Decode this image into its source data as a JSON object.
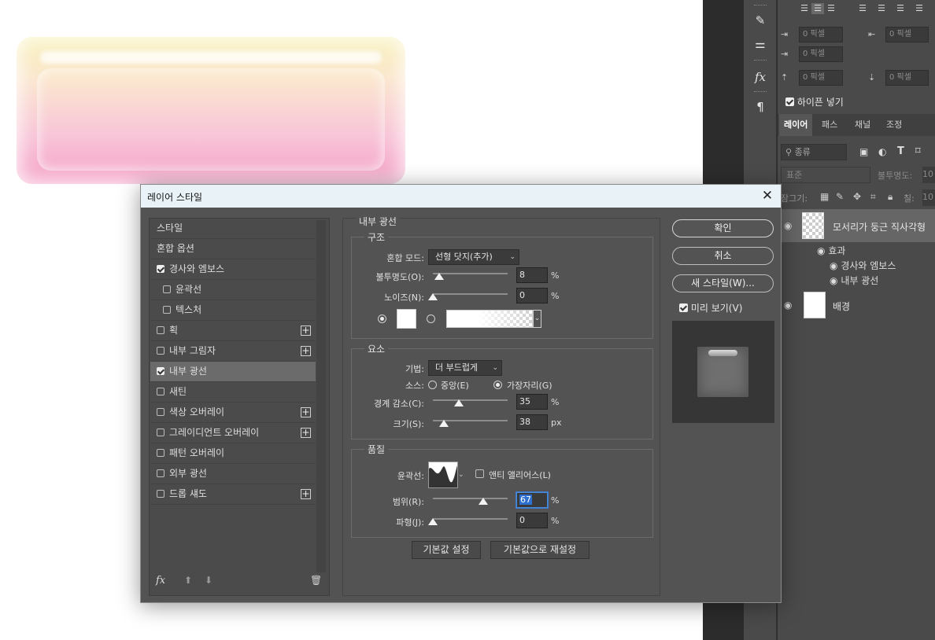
{
  "dialog": {
    "title": "레이어 스타일",
    "ok_label": "확인",
    "cancel_label": "취소",
    "new_style_label": "새 스타일(W)...",
    "preview_label": "미리 보기(V)",
    "preview_checked": true
  },
  "styles_list": [
    {
      "label": "스타일",
      "checkbox": null,
      "plus": false,
      "selected": false
    },
    {
      "label": "혼합 옵션",
      "checkbox": null,
      "plus": false,
      "selected": false
    },
    {
      "label": "경사와 엠보스",
      "checkbox": true,
      "plus": false,
      "selected": false
    },
    {
      "label": "윤곽선",
      "checkbox": false,
      "plus": false,
      "selected": false,
      "sub": true
    },
    {
      "label": "텍스처",
      "checkbox": false,
      "plus": false,
      "selected": false,
      "sub": true
    },
    {
      "label": "획",
      "checkbox": false,
      "plus": true,
      "selected": false
    },
    {
      "label": "내부 그림자",
      "checkbox": false,
      "plus": true,
      "selected": false
    },
    {
      "label": "내부 광선",
      "checkbox": true,
      "plus": false,
      "selected": true
    },
    {
      "label": "새틴",
      "checkbox": false,
      "plus": false,
      "selected": false
    },
    {
      "label": "색상 오버레이",
      "checkbox": false,
      "plus": true,
      "selected": false
    },
    {
      "label": "그레이디언트 오버레이",
      "checkbox": false,
      "plus": true,
      "selected": false
    },
    {
      "label": "패턴 오버레이",
      "checkbox": false,
      "plus": false,
      "selected": false
    },
    {
      "label": "외부 광선",
      "checkbox": false,
      "plus": false,
      "selected": false
    },
    {
      "label": "드롭 섀도",
      "checkbox": false,
      "plus": true,
      "selected": false
    }
  ],
  "list_footer": {
    "fx": "fx"
  },
  "inner_glow": {
    "title": "내부 광선",
    "structure": {
      "title": "구조",
      "blend_mode_label": "혼합 모드:",
      "blend_mode": "선형 닷지(추가)",
      "opacity_label": "불투명도(O):",
      "opacity": "8",
      "opacity_value": 8,
      "noise_label": "노이즈(N):",
      "noise": "0",
      "noise_value": 0,
      "unit": "%"
    },
    "elements": {
      "title": "요소",
      "technique_label": "기법:",
      "technique": "더 부드럽게",
      "source_label": "소스:",
      "source_center": "중앙(E)",
      "source_edge": "가장자리(G)",
      "choke_label": "경계 감소(C):",
      "choke": "35",
      "choke_value": 35,
      "size_label": "크기(S):",
      "size": "38",
      "size_value": 38,
      "unit_pct": "%",
      "unit_px": "px"
    },
    "quality": {
      "title": "품질",
      "contour_label": "윤곽선:",
      "anti_alias_label": "앤티 앨리어스(L)",
      "range_label": "범위(R):",
      "range": "67",
      "range_value": 67,
      "jitter_label": "파형(J):",
      "jitter": "0",
      "jitter_value": 0,
      "unit": "%"
    },
    "make_default_label": "기본값 설정",
    "reset_default_label": "기본값으로 재설정"
  },
  "paragraph_panel": {
    "unit_placeholder": "0 픽셀",
    "hyphenate_label": "하이픈 넣기",
    "hyphenate_checked": true
  },
  "layers_panel": {
    "tabs": [
      "레이어",
      "패스",
      "채널",
      "조정"
    ],
    "kind_filter": "종류",
    "blend_mode": "표준",
    "opacity_label": "불투명도:",
    "opacity_value": "10",
    "lock_label": "잠그기:",
    "fill_label": "칠:",
    "fill_value": "10",
    "layers": [
      {
        "name": "모서리가 둥근 직사각형"
      },
      {
        "name": "배경"
      }
    ],
    "effects_label": "효과",
    "effects": [
      "경사와 엠보스",
      "내부 광선"
    ]
  }
}
